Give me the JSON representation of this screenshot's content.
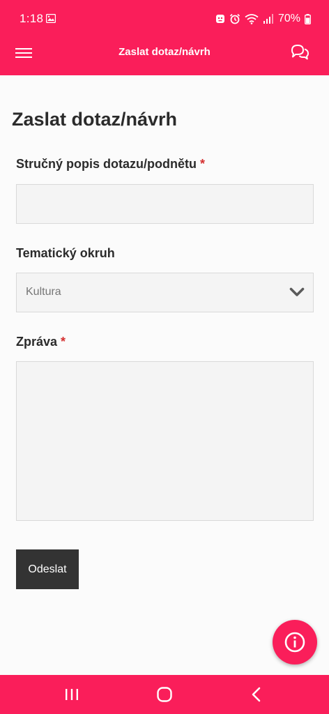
{
  "status_bar": {
    "time": "1:18",
    "battery": "70%"
  },
  "toolbar": {
    "title": "Zaslat dotaz/návrh",
    "menu_icon": "hamburger-menu-icon",
    "chat_icon": "chat-bubbles-icon"
  },
  "page": {
    "title": "Zaslat dotaz/návrh"
  },
  "form": {
    "subject": {
      "label": "Stručný popis dotazu/podnětu",
      "required_mark": "*",
      "value": ""
    },
    "topic": {
      "label": "Tematický okruh",
      "selected": "Kultura"
    },
    "message": {
      "label": "Zpráva",
      "required_mark": "*",
      "value": ""
    },
    "submit_label": "Odeslat"
  },
  "fab": {
    "icon": "info-icon"
  },
  "colors": {
    "accent": "#fa1e5a",
    "button": "#333333",
    "required": "#d42f2f"
  }
}
